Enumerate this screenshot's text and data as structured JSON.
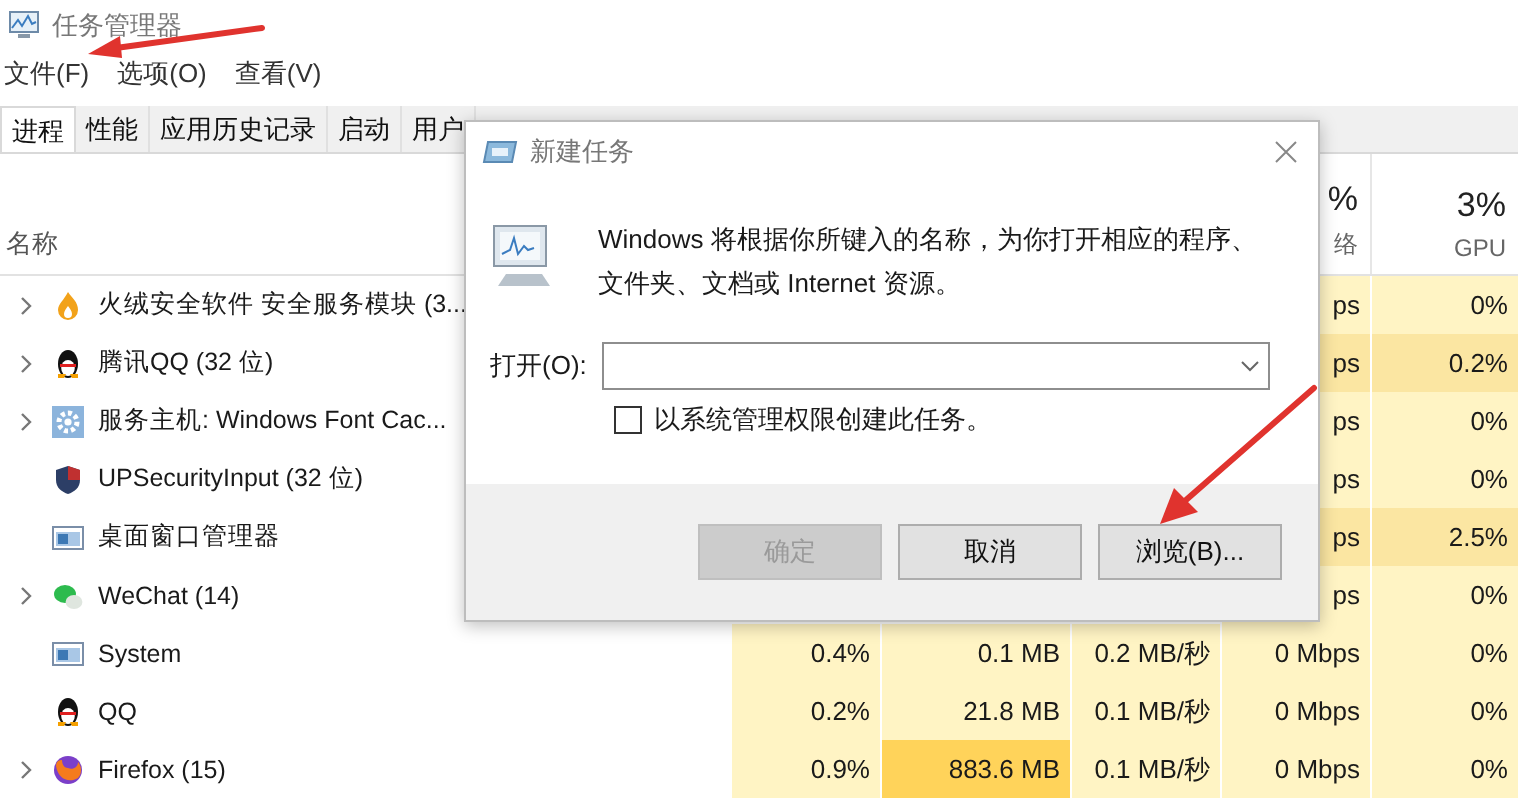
{
  "window": {
    "title": "任务管理器"
  },
  "menu": [
    {
      "label": "文件(F)"
    },
    {
      "label": "选项(O)"
    },
    {
      "label": "查看(V)"
    }
  ],
  "tabs": [
    {
      "label": "进程",
      "selected": true
    },
    {
      "label": "性能",
      "selected": false
    },
    {
      "label": "应用历史记录",
      "selected": false
    },
    {
      "label": "启动",
      "selected": false
    },
    {
      "label": "用户",
      "selected": false
    }
  ],
  "header": {
    "name": "名称",
    "network": {
      "total": "%",
      "label": "络"
    },
    "gpu": {
      "total": "3%",
      "label": "GPU"
    }
  },
  "rows": [
    {
      "name": "火绒安全软件 安全服务模块 (3...",
      "expandable": true,
      "kind": "flame",
      "network": {
        "text": "ps",
        "color": "#fff4c4"
      },
      "gpu": {
        "text": "0%",
        "color": "#fff4c4"
      }
    },
    {
      "name": "腾讯QQ (32 位)",
      "expandable": true,
      "kind": "penguin",
      "network": {
        "text": "ps",
        "color": "#fbe6a2"
      },
      "gpu": {
        "text": "0.2%",
        "color": "#fbe6a2"
      }
    },
    {
      "name": "服务主机: Windows Font Cac...",
      "expandable": true,
      "kind": "gear",
      "network": {
        "text": "ps",
        "color": "#fff4c4"
      },
      "gpu": {
        "text": "0%",
        "color": "#fff4c4"
      }
    },
    {
      "name": "UPSecurityInput (32 位)",
      "expandable": false,
      "kind": "shield",
      "network": {
        "text": "ps",
        "color": "#fff4c4"
      },
      "gpu": {
        "text": "0%",
        "color": "#fff4c4"
      }
    },
    {
      "name": "桌面窗口管理器",
      "expandable": false,
      "kind": "window",
      "network": {
        "text": "ps",
        "color": "#fbe6a2"
      },
      "gpu": {
        "text": "2.5%",
        "color": "#fbe6a2"
      }
    },
    {
      "name": "WeChat (14)",
      "expandable": true,
      "kind": "chat",
      "network": {
        "text": "ps",
        "color": "#fff4c4"
      },
      "gpu": {
        "text": "0%",
        "color": "#fff4c4"
      }
    },
    {
      "name": "System",
      "expandable": false,
      "kind": "window",
      "cpu": {
        "text": "0.4%",
        "color": "#fff4c4"
      },
      "memory": {
        "text": "0.1 MB",
        "color": "#fff4c4"
      },
      "disk": {
        "text": "0.2 MB/秒",
        "color": "#fff4c4"
      },
      "network": {
        "text": "0 Mbps",
        "color": "#fff4c4"
      },
      "gpu": {
        "text": "0%",
        "color": "#fff4c4"
      }
    },
    {
      "name": "QQ",
      "expandable": false,
      "kind": "penguin",
      "cpu": {
        "text": "0.2%",
        "color": "#fff4c4"
      },
      "memory": {
        "text": "21.8 MB",
        "color": "#fff4c4"
      },
      "disk": {
        "text": "0.1 MB/秒",
        "color": "#fff4c4"
      },
      "network": {
        "text": "0 Mbps",
        "color": "#fff4c4"
      },
      "gpu": {
        "text": "0%",
        "color": "#fff4c4"
      }
    },
    {
      "name": "Firefox (15)",
      "expandable": true,
      "kind": "fox",
      "cpu": {
        "text": "0.9%",
        "color": "#fff4c4"
      },
      "memory": {
        "text": "883.6 MB",
        "color": "#ffd35a"
      },
      "disk": {
        "text": "0.1 MB/秒",
        "color": "#fff4c4"
      },
      "network": {
        "text": "0 Mbps",
        "color": "#fff4c4"
      },
      "gpu": {
        "text": "0%",
        "color": "#fff4c4"
      }
    }
  ],
  "dialog": {
    "title": "新建任务",
    "message": "Windows 将根据你所键入的名称，为你打开相应的程序、文件夹、文档或 Internet 资源。",
    "open_label": "打开(O):",
    "admin_checkbox": {
      "label": "以系统管理权限创建此任务。",
      "checked": false
    },
    "buttons": [
      {
        "label": "确定",
        "disabled": true
      },
      {
        "label": "取消",
        "disabled": false
      },
      {
        "label": "浏览(B)...",
        "disabled": false
      }
    ]
  }
}
